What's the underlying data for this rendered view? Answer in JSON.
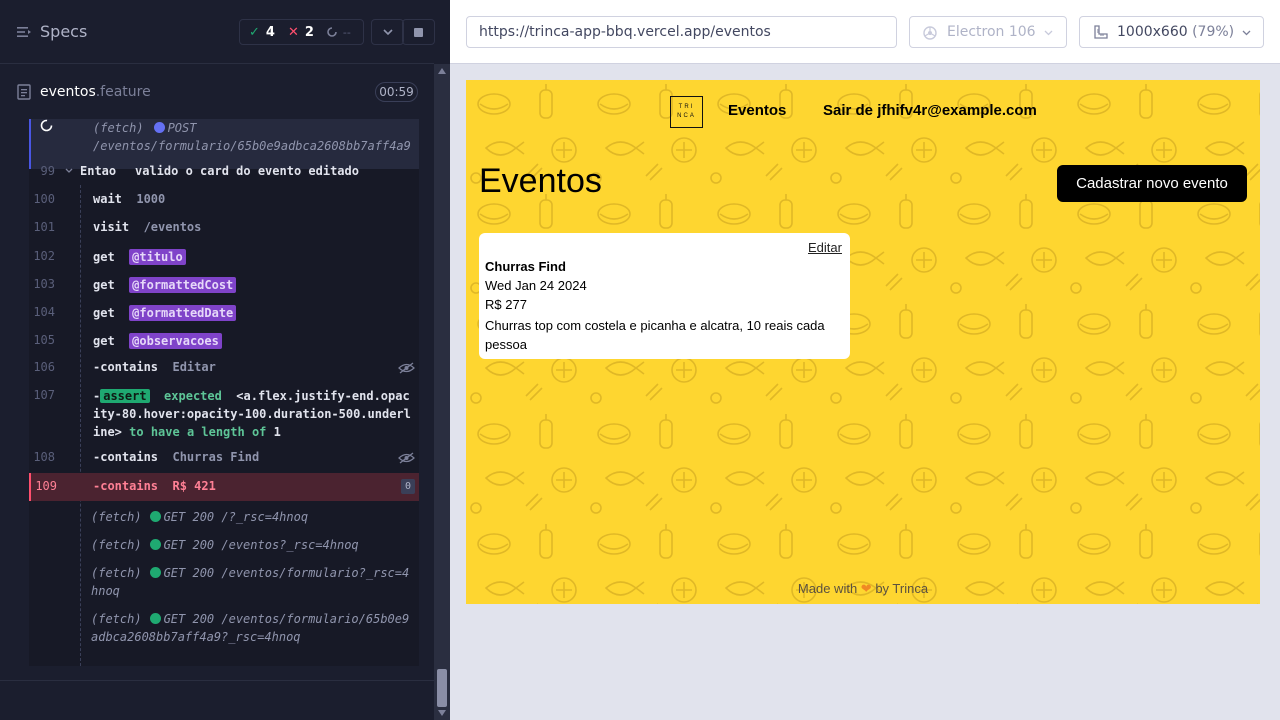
{
  "reporter": {
    "title": "Specs",
    "stats": {
      "passed": "4",
      "failed": "2",
      "pending": "--"
    },
    "spec_file": {
      "name": "eventos",
      "ext": ".feature",
      "duration": "00:59"
    },
    "log": {
      "fetch_post": {
        "type": "(fetch)",
        "method": "POST",
        "path": "/eventos/formulario/65b0e9adbca2608bb7aff4a9"
      },
      "r99": {
        "line": "99",
        "keyword": "Entao",
        "step": "valido o card do evento editado"
      },
      "r100": {
        "line": "100",
        "cmd": "wait",
        "msg": "1000"
      },
      "r101": {
        "line": "101",
        "cmd": "visit",
        "msg": "/eventos"
      },
      "r102": {
        "line": "102",
        "cmd": "get",
        "alias": "@titulo"
      },
      "r103": {
        "line": "103",
        "cmd": "get",
        "alias": "@formattedCost"
      },
      "r104": {
        "line": "104",
        "cmd": "get",
        "alias": "@formattedDate"
      },
      "r105": {
        "line": "105",
        "cmd": "get",
        "alias": "@observacoes"
      },
      "r106": {
        "line": "106",
        "cmd": "-contains",
        "msg": "Editar"
      },
      "r107": {
        "line": "107",
        "prefix": "-",
        "badge": "assert",
        "text_1": "expected",
        "selector": "<a.flex.justify-end.opacity-80.hover:opacity-100.duration-500.underline>",
        "text_2": "to have a length of",
        "value": "1"
      },
      "r108": {
        "line": "108",
        "cmd": "-contains",
        "msg": "Churras Find"
      },
      "r109": {
        "line": "109",
        "cmd": "-contains",
        "msg": "R$ 421",
        "count": "0"
      },
      "f1": {
        "type": "(fetch)",
        "req": "GET 200 /?_rsc=4hnoq"
      },
      "f2": {
        "type": "(fetch)",
        "req": "GET 200 /eventos?_rsc=4hnoq"
      },
      "f3": {
        "type": "(fetch)",
        "req": "GET 200 /eventos/formulario?_rsc=4hnoq"
      },
      "f4": {
        "type": "(fetch)",
        "req": "GET 200 /eventos/formulario/65b0e9adbca2608bb7aff4a9?_rsc=4hnoq"
      }
    }
  },
  "aut_header": {
    "url": "https://trinca-app-bbq.vercel.app/eventos",
    "browser": "Electron 106",
    "viewport": "1000x660",
    "scale": "(79%)"
  },
  "app": {
    "logo": "TRI NCA",
    "nav": {
      "eventos": "Eventos",
      "logout": "Sair de jfhifv4r@example.com"
    },
    "page_title": "Eventos",
    "new_event_button": "Cadastrar novo evento",
    "card": {
      "edit": "Editar",
      "title": "Churras Find",
      "date": "Wed Jan 24 2024",
      "cost": "R$ 277",
      "notes": "Churras top com costela e picanha e alcatra, 10 reais cada pessoa"
    },
    "footer": {
      "prefix": "Made with",
      "heart": "❤",
      "suffix": "by Trinca"
    }
  },
  "colors": {
    "reporter_bg": "#1b1e2e",
    "app_bg": "#fed630",
    "pass": "#1fa971",
    "fail": "#ff4f6e",
    "alias": "#7f43c9"
  },
  "icons": [
    "list-icon",
    "check-icon",
    "x-icon",
    "spinner-icon",
    "chevron-down-icon",
    "stop-icon",
    "document-icon",
    "eye-slash-icon",
    "browser-icon",
    "ruler-icon"
  ]
}
